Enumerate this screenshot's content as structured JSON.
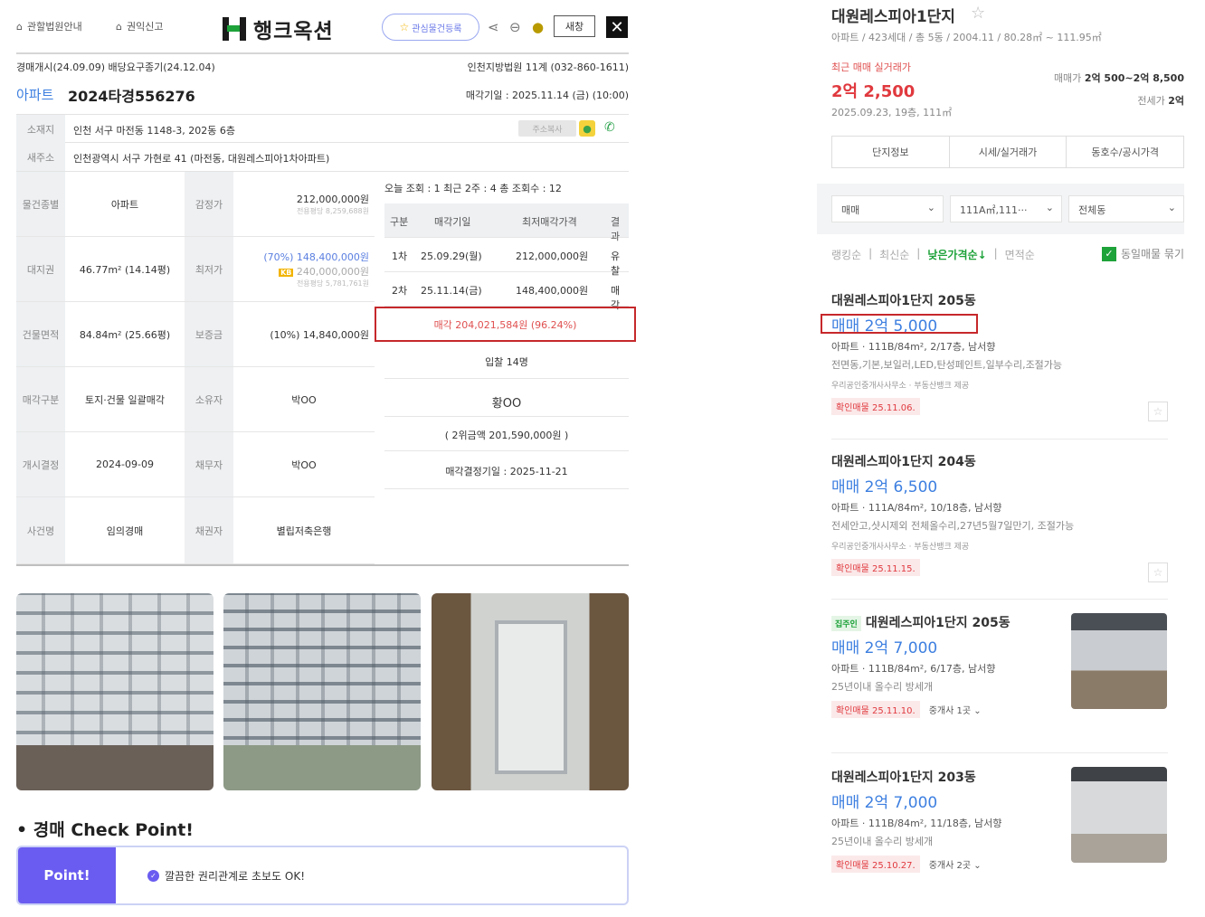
{
  "nav": {
    "link1": "관할법원안내",
    "link2": "권익신고",
    "logo": "행크옥션",
    "fav": "관심물건등록",
    "print": "새창"
  },
  "case": {
    "top_left": "경매개시(24.09.09) 배당요구종기(24.12.04)",
    "court": "인천지방법원 11계 (032-860-1611)",
    "category": "아파트",
    "number": "2024타경556276",
    "sale_date": "매각기일 : 2025.11.14 (금) (10:00)",
    "addr_label": "소재지",
    "addr": "인천 서구 마전동 1148-3, 202동 6층",
    "addr_btn": "주소복사",
    "road_label": "새주소",
    "road": "인천광역시 서구 가현로 41 (마전동, 대원레스피아1차아파트)"
  },
  "grid": {
    "r1": {
      "l1": "물건종별",
      "v1": "아파트",
      "l2": "감정가",
      "v2": "212,000,000원",
      "v2s": "전용평당 8,259,688원"
    },
    "r2": {
      "l1": "대지권",
      "v1": "46.77m² (14.14평)",
      "l2": "최저가",
      "v2": "(70%) 148,400,000원",
      "kb": "KB",
      "v2b": "240,000,000원",
      "v2s": "전용평당 5,781,761원"
    },
    "r3": {
      "l1": "건물면적",
      "v1": "84.84m² (25.66평)",
      "l2": "보증금",
      "v2": "(10%) 14,840,000원"
    },
    "r4": {
      "l1": "매각구분",
      "v1": "토지·건물 일괄매각",
      "l2": "소유자",
      "v2": "박OO"
    },
    "r5": {
      "l1": "개시결정",
      "v1": "2024-09-09",
      "l2": "채무자",
      "v2": "박OO"
    },
    "r6": {
      "l1": "사건명",
      "v1": "임의경매",
      "l2": "채권자",
      "v2": "별립저축은행"
    }
  },
  "history": {
    "stats": "오늘 조회 : 1   최근 2주 : 4   총 조회수 : 12",
    "head": [
      "구분",
      "매각기일",
      "최저매각가격",
      "결과"
    ],
    "rows": [
      [
        "1차",
        "25.09.29(월)",
        "212,000,000원",
        "유찰"
      ],
      [
        "2차",
        "25.11.14(금)",
        "148,400,000원",
        "매각"
      ]
    ],
    "sold": "매각 204,021,584원 (96.24%)",
    "bidders": "입찰 14명",
    "winner": "황OO",
    "second": "( 2위금액 201,590,000원 )",
    "decision": "매각결정기일 : 2025-11-21"
  },
  "checkpoint": {
    "title": "• 경매 Check Point!",
    "point": "Point!",
    "text": "깔끔한 권리관계로 초보도 OK!"
  },
  "right": {
    "title": "대원레스피아1단지",
    "meta": "아파트 / 423세대 / 총 5동 / 2004.11 / 80.28㎡ ~ 111.95㎡",
    "recent_label": "최근 매매 실거래가",
    "recent_price": "2억 2,500",
    "recent_date": "2025.09.23, 19층, 111㎡",
    "sale_label": "매매가",
    "sale_range": "2억 500~2억 8,500",
    "jeonse_label": "전세가",
    "jeonse": "2억",
    "tabs": [
      "단지정보",
      "시세/실거래가",
      "동호수/공시가격"
    ],
    "filters": [
      "매매",
      "111A㎡,111···",
      "전체동"
    ],
    "sorts": [
      "랭킹순",
      "최신순",
      "낮은가격순↓",
      "면적순"
    ],
    "same": "동일매물 묶기"
  },
  "listings": [
    {
      "name": "대원레스피아1단지 205동",
      "price": "매매 2억 5,000",
      "spec": "아파트 · 111B/84m², 2/17층, 남서향",
      "desc": "전면동,기본,보일러,LED,탄성페인트,일부수리,조절가능",
      "agent": "우리공인중개사사무소 · 부동산뱅크 제공",
      "conf": "확인매물 25.11.06."
    },
    {
      "name": "대원레스피아1단지 204동",
      "price": "매매 2억 6,500",
      "spec": "아파트 · 111A/84m², 10/18층, 남서향",
      "desc": "전세안고,샷시제외 전체올수리,27년5월7일만기, 조절가능",
      "agent": "우리공인중개사사무소 · 부동산뱅크 제공",
      "conf": "확인매물 25.11.15."
    },
    {
      "tag": "집주인",
      "name": "대원레스피아1단지 205동",
      "price": "매매 2억 7,000",
      "spec": "아파트 · 111B/84m², 6/17층, 남서향",
      "desc": "25년이내  올수리  방세개",
      "conf": "확인매물 25.11.10.",
      "more": "중개사 1곳"
    },
    {
      "name": "대원레스피아1단지 203동",
      "price": "매매 2억 7,000",
      "spec": "아파트 · 111B/84m², 11/18층, 남서향",
      "desc": "25년이내  올수리  방세개",
      "conf": "확인매물 25.10.27.",
      "more": "중개사 2곳"
    }
  ]
}
